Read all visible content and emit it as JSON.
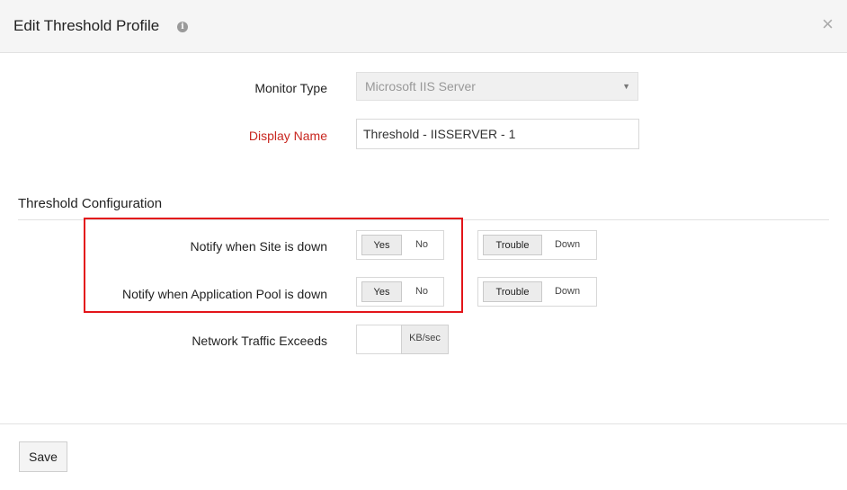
{
  "dialog": {
    "title": "Edit Threshold Profile",
    "info_glyph": "i",
    "close_glyph": "×"
  },
  "form": {
    "monitor_type_label": "Monitor Type",
    "monitor_type_value": "Microsoft IIS Server",
    "display_name_label": "Display Name",
    "display_name_value": "Threshold - IISSERVER - 1"
  },
  "threshold_config": {
    "title": "Threshold Configuration",
    "rows": [
      {
        "label": "Notify when Site is down",
        "notify": {
          "yes": "Yes",
          "no": "No",
          "selected": "Yes"
        },
        "severity": {
          "trouble": "Trouble",
          "down": "Down",
          "selected": "Trouble"
        }
      },
      {
        "label": "Notify when Application Pool is down",
        "notify": {
          "yes": "Yes",
          "no": "No",
          "selected": "Yes"
        },
        "severity": {
          "trouble": "Trouble",
          "down": "Down",
          "selected": "Trouble"
        }
      }
    ],
    "network_traffic_label": "Network Traffic Exceeds",
    "network_traffic_value": "",
    "network_traffic_unit": "KB/sec"
  },
  "footer": {
    "save_label": "Save"
  },
  "colors": {
    "required_label": "#c8261f",
    "highlight_border": "#e3151a"
  },
  "icons": {
    "info": "info-icon",
    "close": "close-icon",
    "dropdown": "chevron-down-icon"
  }
}
